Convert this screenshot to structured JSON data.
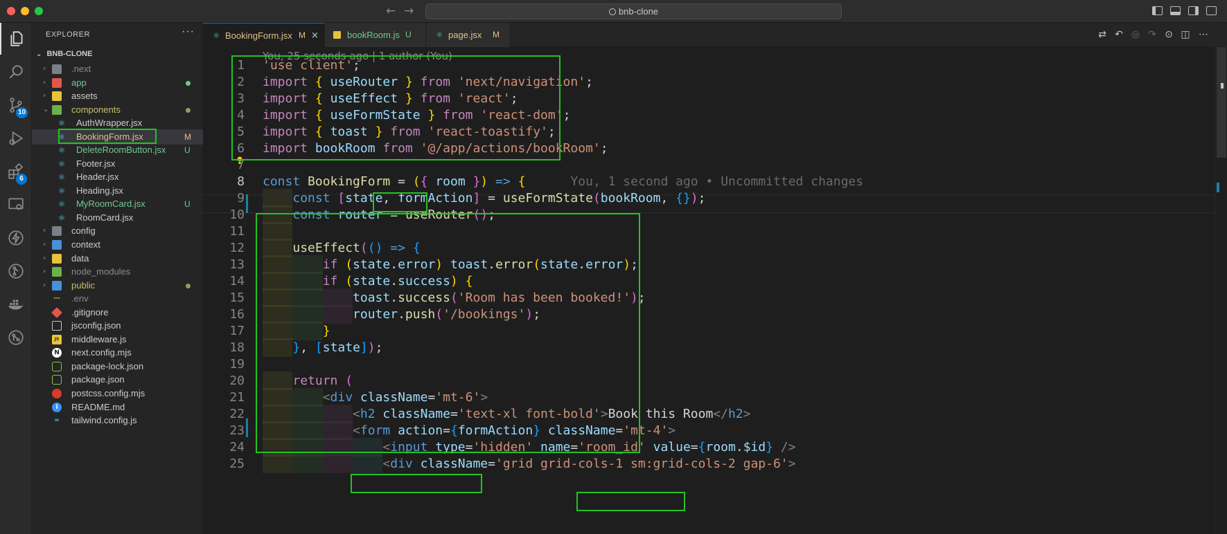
{
  "window": {
    "search_text": "bnb-clone",
    "back_arrow": "←",
    "forward_arrow": "→"
  },
  "activity_bar": {
    "source_control_badge": "10",
    "extensions_badge": "6"
  },
  "explorer": {
    "title": "EXPLORER",
    "more_label": "···",
    "project": "BNB-CLONE",
    "items": [
      {
        "label": ".next",
        "color": "#8c8c8c"
      },
      {
        "label": "app",
        "color": "#73c991"
      },
      {
        "label": "assets",
        "color": "#cccccc"
      },
      {
        "label": "components",
        "color": "#c9c06a"
      },
      {
        "label": "AuthWrapper.jsx",
        "color": "#cccccc"
      },
      {
        "label": "BookingForm.jsx",
        "color": "#e2c08d",
        "status": "M"
      },
      {
        "label": "DeleteRoomButton.jsx",
        "color": "#73c991",
        "status": "U"
      },
      {
        "label": "Footer.jsx",
        "color": "#cccccc"
      },
      {
        "label": "Header.jsx",
        "color": "#cccccc"
      },
      {
        "label": "Heading.jsx",
        "color": "#cccccc"
      },
      {
        "label": "MyRoomCard.jsx",
        "color": "#73c991",
        "status": "U"
      },
      {
        "label": "RoomCard.jsx",
        "color": "#cccccc"
      },
      {
        "label": "config",
        "color": "#cccccc"
      },
      {
        "label": "context",
        "color": "#cccccc"
      },
      {
        "label": "data",
        "color": "#cccccc"
      },
      {
        "label": "node_modules",
        "color": "#8c8c8c"
      },
      {
        "label": "public",
        "color": "#c9c06a"
      },
      {
        "label": ".env",
        "color": "#8c8c8c"
      },
      {
        "label": ".gitignore",
        "color": "#cccccc"
      },
      {
        "label": "jsconfig.json",
        "color": "#cccccc"
      },
      {
        "label": "middleware.js",
        "color": "#cccccc"
      },
      {
        "label": "next.config.mjs",
        "color": "#cccccc"
      },
      {
        "label": "package-lock.json",
        "color": "#cccccc"
      },
      {
        "label": "package.json",
        "color": "#cccccc"
      },
      {
        "label": "postcss.config.mjs",
        "color": "#cccccc"
      },
      {
        "label": "README.md",
        "color": "#cccccc"
      },
      {
        "label": "tailwind.config.js",
        "color": "#cccccc"
      }
    ]
  },
  "tabs": [
    {
      "label": "BookingForm.jsx",
      "status": "M",
      "active": true,
      "close": "×"
    },
    {
      "label": "bookRoom.js",
      "status": "U",
      "active": false
    },
    {
      "label": "page.jsx",
      "status": "M",
      "active": false
    }
  ],
  "editor": {
    "blame_header": "You, 25 seconds ago | 1 author (You)",
    "inline_blame": "You, 1 second ago • Uncommitted changes",
    "line_numbers": [
      "1",
      "2",
      "3",
      "4",
      "5",
      "6",
      "7",
      "8",
      "9",
      "10",
      "11",
      "12",
      "13",
      "14",
      "15",
      "16",
      "17",
      "18",
      "19",
      "20",
      "21",
      "22",
      "23",
      "24",
      "25"
    ],
    "tokens": {
      "l1": [
        "'use client'",
        ";"
      ],
      "l2": [
        "import",
        "{",
        "useRouter",
        "}",
        "from",
        "'next/navigation'",
        ";"
      ],
      "l3": [
        "import",
        "{",
        "useEffect",
        "}",
        "from",
        "'react'",
        ";"
      ],
      "l4": [
        "import",
        "{",
        "useFormState",
        "}",
        "from",
        "'react-dom'",
        ";"
      ],
      "l5": [
        "import",
        "{",
        "toast",
        "}",
        "from",
        "'react-toastify'",
        ";"
      ],
      "l6": [
        "import",
        "bookRoom",
        "from",
        "'@/app/actions/bookRoom'",
        ";"
      ],
      "l8": [
        "const",
        "BookingForm",
        "=",
        "(",
        "{",
        "room",
        "}",
        ")",
        "=>",
        "{"
      ],
      "l9": [
        "const",
        "[",
        "state",
        ",",
        "formAction",
        "]",
        "=",
        "useFormState",
        "(",
        "bookRoom",
        ",",
        "{}",
        ")",
        ";"
      ],
      "l10": [
        "const",
        "router",
        "=",
        "useRouter",
        "()",
        ";"
      ],
      "l12": [
        "useEffect",
        "(",
        "()",
        "=>",
        "{"
      ],
      "l13": [
        "if",
        "(",
        "state",
        ".",
        "error",
        ")",
        "toast",
        ".",
        "error",
        "(",
        "state",
        ".",
        "error",
        ")",
        ";"
      ],
      "l14": [
        "if",
        "(",
        "state",
        ".",
        "success",
        ")",
        "{"
      ],
      "l15": [
        "toast",
        ".",
        "success",
        "(",
        "'Room has been booked!'",
        ")",
        ";"
      ],
      "l16": [
        "router",
        ".",
        "push",
        "(",
        "'/bookings'",
        ")",
        ";"
      ],
      "l17": [
        "}"
      ],
      "l18": [
        "}",
        ",",
        "[",
        "state",
        "]",
        ")",
        ";"
      ],
      "l20": [
        "return",
        "("
      ],
      "l21": [
        "<",
        "div",
        "className",
        "=",
        "'mt-6'",
        ">"
      ],
      "l22": [
        "<",
        "h2",
        "className",
        "=",
        "'text-xl font-bold'",
        ">",
        "Book this Room",
        "</",
        "h2",
        ">"
      ],
      "l23": [
        "<",
        "form",
        "action",
        "=",
        "{",
        "formAction",
        "}",
        "className",
        "=",
        "'mt-4'",
        ">"
      ],
      "l24": [
        "<",
        "input",
        "type",
        "=",
        "'hidden'",
        "name",
        "=",
        "'room_id'",
        "value",
        "=",
        "{",
        "room",
        ".",
        "$id",
        "}",
        "/>"
      ],
      "l25": [
        "<",
        "div",
        "className",
        "=",
        "'grid grid-cols-1 sm:grid-cols-2 gap-6'",
        ">"
      ]
    }
  },
  "colors": {
    "highlight": "#22c422",
    "accent": "#0078d4"
  }
}
